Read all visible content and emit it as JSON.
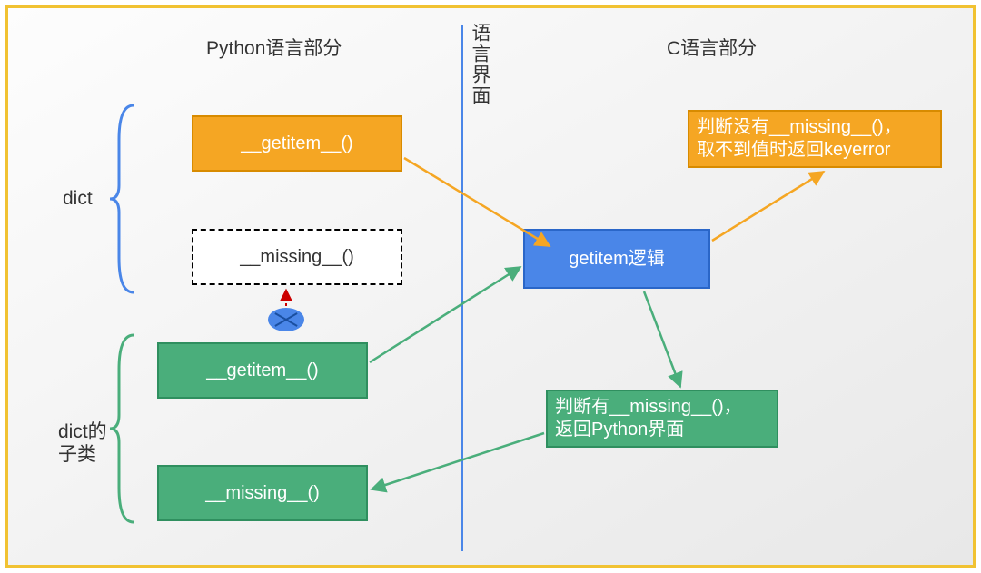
{
  "headers": {
    "python_side": "Python语言部分",
    "c_side": "C语言部分",
    "divider_label": "语言界面"
  },
  "group_labels": {
    "dict": "dict",
    "dict_subclass_line1": "dict的",
    "dict_subclass_line2": "子类"
  },
  "boxes": {
    "dict_getitem": "__getitem__()",
    "dict_missing": "__missing__()",
    "sub_getitem": "__getitem__()",
    "sub_missing": "__missing__()",
    "getitem_logic": "getitem逻辑",
    "no_missing_line1": "判断没有__missing__()，",
    "no_missing_line2": "取不到值时返回keyerror",
    "has_missing_line1": "判断有__missing__()，",
    "has_missing_line2": "返回Python界面"
  },
  "colors": {
    "orange": "#f5a623",
    "green": "#4aae7b",
    "blue": "#4a86e8",
    "border_yellow": "#f1c232"
  }
}
